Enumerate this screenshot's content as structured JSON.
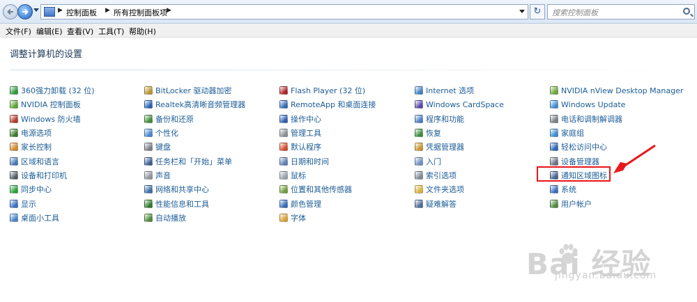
{
  "address": {
    "crumbs": [
      "控制面板",
      "所有控制面板项"
    ],
    "search_placeholder": "搜索控制面板"
  },
  "menu": [
    "文件(F)",
    "编辑(E)",
    "查看(V)",
    "工具(T)",
    "帮助(H)"
  ],
  "heading": "调整计算机的设置",
  "columns": [
    [
      {
        "label": "360强力卸载 (32 位)",
        "icon": "uninstall-icon",
        "color": "#2e9a3a"
      },
      {
        "label": "NVIDIA 控制面板",
        "icon": "nvidia-icon",
        "color": "#5ea531"
      },
      {
        "label": "Windows 防火墙",
        "icon": "firewall-icon",
        "color": "#b23b2b"
      },
      {
        "label": "电源选项",
        "icon": "power-icon",
        "color": "#3e7a2e"
      },
      {
        "label": "家长控制",
        "icon": "parental-icon",
        "color": "#d0892c"
      },
      {
        "label": "区域和语言",
        "icon": "globe-clock-icon",
        "color": "#4a78b8"
      },
      {
        "label": "设备和打印机",
        "icon": "printer-icon",
        "color": "#555b66"
      },
      {
        "label": "同步中心",
        "icon": "sync-icon",
        "color": "#2ba33a"
      },
      {
        "label": "显示",
        "icon": "display-icon",
        "color": "#3a6fc3"
      },
      {
        "label": "桌面小工具",
        "icon": "gadgets-icon",
        "color": "#4b84c9"
      }
    ],
    [
      {
        "label": "BitLocker 驱动器加密",
        "icon": "bitlocker-icon",
        "color": "#b7952e"
      },
      {
        "label": "Realtek高清晰音频管理器",
        "icon": "realtek-icon",
        "color": "#2a62b8"
      },
      {
        "label": "备份和还原",
        "icon": "backup-icon",
        "color": "#3f8c3a"
      },
      {
        "label": "个性化",
        "icon": "personalize-icon",
        "color": "#4a86cf"
      },
      {
        "label": "键盘",
        "icon": "keyboard-icon",
        "color": "#7a7f86"
      },
      {
        "label": "任务栏和「开始」菜单",
        "icon": "taskbar-icon",
        "color": "#3b5e91"
      },
      {
        "label": "声音",
        "icon": "speaker-icon",
        "color": "#8f959c"
      },
      {
        "label": "网络和共享中心",
        "icon": "network-icon",
        "color": "#3d6ea6"
      },
      {
        "label": "性能信息和工具",
        "icon": "performance-icon",
        "color": "#2b7a2b"
      },
      {
        "label": "自动播放",
        "icon": "autoplay-icon",
        "color": "#4e8a3b"
      }
    ],
    [
      {
        "label": "Flash Player (32 位)",
        "icon": "flash-icon",
        "color": "#b22222"
      },
      {
        "label": "RemoteApp 和桌面连接",
        "icon": "remoteapp-icon",
        "color": "#3569b5"
      },
      {
        "label": "操作中心",
        "icon": "flag-icon",
        "color": "#2f5fb3"
      },
      {
        "label": "管理工具",
        "icon": "admin-tools-icon",
        "color": "#8a8f96"
      },
      {
        "label": "默认程序",
        "icon": "default-programs-icon",
        "color": "#d24a2a"
      },
      {
        "label": "日期和时间",
        "icon": "calendar-clock-icon",
        "color": "#5b7fb0"
      },
      {
        "label": "鼠标",
        "icon": "mouse-icon",
        "color": "#9aa0a6"
      },
      {
        "label": "位置和其他传感器",
        "icon": "sensor-icon",
        "color": "#6e9d3a"
      },
      {
        "label": "颜色管理",
        "icon": "color-icon",
        "color": "#2f6bb8"
      },
      {
        "label": "字体",
        "icon": "font-icon",
        "color": "#d8a02f"
      }
    ],
    [
      {
        "label": "Internet 选项",
        "icon": "internet-icon",
        "color": "#3e80c4"
      },
      {
        "label": "Windows CardSpace",
        "icon": "cardspace-icon",
        "color": "#5a48a8"
      },
      {
        "label": "程序和功能",
        "icon": "programs-icon",
        "color": "#4a7ec0"
      },
      {
        "label": "恢复",
        "icon": "recovery-icon",
        "color": "#3c8c3c"
      },
      {
        "label": "凭据管理器",
        "icon": "credential-icon",
        "color": "#c7962f"
      },
      {
        "label": "入门",
        "icon": "getting-started-icon",
        "color": "#6b8fbf"
      },
      {
        "label": "索引选项",
        "icon": "indexing-icon",
        "color": "#7e8a96"
      },
      {
        "label": "文件夹选项",
        "icon": "folder-icon",
        "color": "#d9b23c"
      },
      {
        "label": "疑难解答",
        "icon": "troubleshoot-icon",
        "color": "#4f6d96"
      }
    ],
    [
      {
        "label": "NVIDIA nView Desktop Manager",
        "icon": "nview-icon",
        "color": "#6aa536"
      },
      {
        "label": "Windows Update",
        "icon": "windows-update-icon",
        "color": "#3f8bd0"
      },
      {
        "label": "电话和调制解调器",
        "icon": "phone-modem-icon",
        "color": "#7a7f86"
      },
      {
        "label": "家庭组",
        "icon": "homegroup-icon",
        "color": "#3f8bd0"
      },
      {
        "label": "轻松访问中心",
        "icon": "ease-of-access-icon",
        "color": "#2d66b5"
      },
      {
        "label": "设备管理器",
        "icon": "device-manager-icon",
        "color": "#6b7380"
      },
      {
        "label": "通知区域图标",
        "icon": "notification-area-icon",
        "color": "#44638f"
      },
      {
        "label": "系统",
        "icon": "system-icon",
        "color": "#3a6fbe"
      },
      {
        "label": "用户帐户",
        "icon": "user-accounts-icon",
        "color": "#4e8a3b"
      }
    ]
  ],
  "highlighted_item": "通知区域图标",
  "watermark": {
    "brand": "Bai  经验",
    "sub": "jingyan.baidu.com"
  },
  "colors": {
    "link": "#1c5c96",
    "heading": "#1e395b",
    "highlight": "#e8161b"
  }
}
